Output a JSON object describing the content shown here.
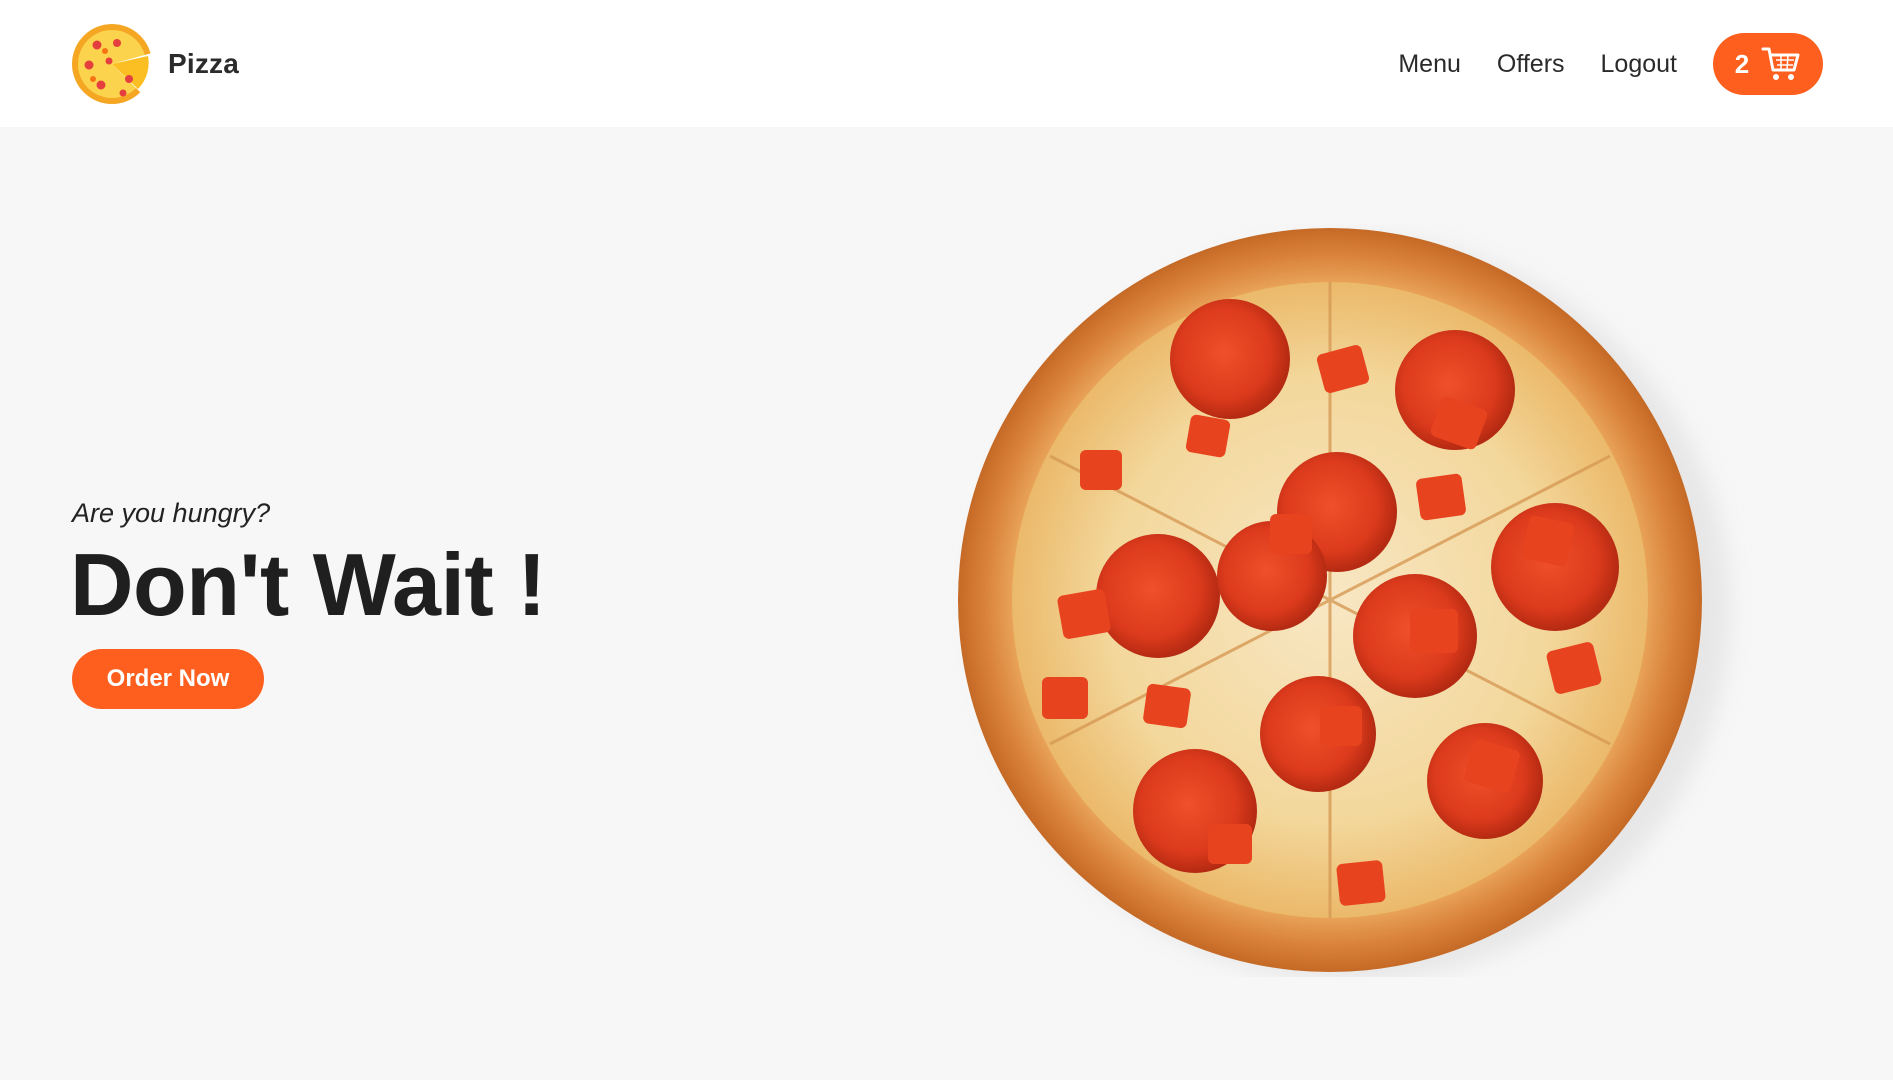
{
  "brand": {
    "name": "Pizza",
    "logo_icon": "pizza-logo-icon"
  },
  "nav": {
    "links": [
      "Menu",
      "Offers",
      "Logout"
    ],
    "cart": {
      "count": "2",
      "icon": "shopping-cart-icon"
    }
  },
  "hero": {
    "subtitle": "Are you hungry?",
    "title": "Don't Wait !",
    "cta_label": "Order Now",
    "image": "pepperoni-pizza-image"
  },
  "colors": {
    "accent": "#fe5f1e",
    "background": "#f7f7f7",
    "navbar": "#ffffff",
    "text": "#1f1f1f"
  }
}
